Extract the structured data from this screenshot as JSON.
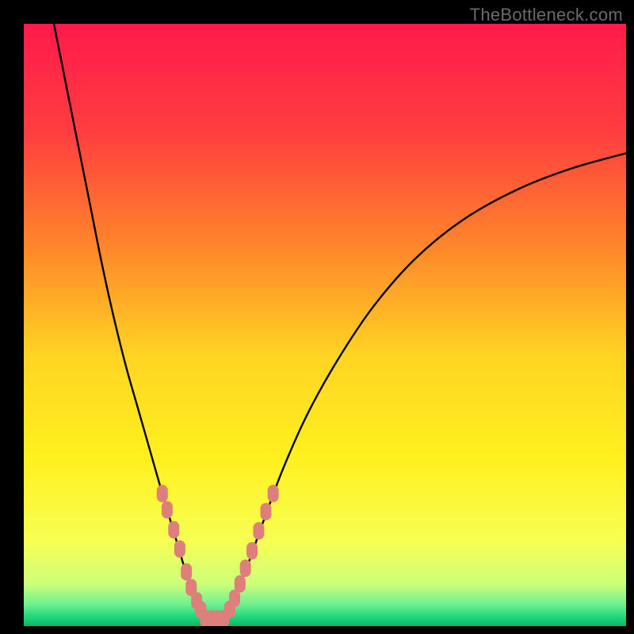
{
  "watermark": "TheBottleneck.com",
  "chart_data": {
    "type": "line",
    "title": "",
    "xlabel": "",
    "ylabel": "",
    "xlim": [
      0,
      100
    ],
    "ylim": [
      0,
      100
    ],
    "background_gradient": {
      "stops": [
        {
          "offset": 0.0,
          "color": "#ff1a4b"
        },
        {
          "offset": 0.18,
          "color": "#ff3e3f"
        },
        {
          "offset": 0.38,
          "color": "#ff8a2a"
        },
        {
          "offset": 0.55,
          "color": "#ffd423"
        },
        {
          "offset": 0.72,
          "color": "#fff01f"
        },
        {
          "offset": 0.86,
          "color": "#f7ff53"
        },
        {
          "offset": 0.93,
          "color": "#ccff7a"
        },
        {
          "offset": 0.965,
          "color": "#6cf08f"
        },
        {
          "offset": 0.985,
          "color": "#1fd67a"
        },
        {
          "offset": 1.0,
          "color": "#0cb56a"
        }
      ]
    },
    "series": [
      {
        "name": "left-branch",
        "comment": "descending curve from top-left into the V minimum",
        "x": [
          5,
          7,
          9,
          11,
          13,
          15,
          17,
          19,
          21,
          23,
          24.5,
          26,
          27,
          27.8,
          28.5,
          29.2,
          30,
          30.5
        ],
        "y": [
          100,
          90,
          80,
          70,
          60,
          51,
          43,
          36,
          29,
          22,
          17,
          12,
          8.5,
          6,
          4.2,
          3,
          1.8,
          1.2
        ]
      },
      {
        "name": "right-branch",
        "comment": "ascending curve from the V minimum out to the right edge",
        "x": [
          33.5,
          34,
          35,
          36,
          37.5,
          40,
          43,
          47,
          52,
          58,
          65,
          73,
          82,
          91,
          100
        ],
        "y": [
          1.2,
          2,
          4,
          7,
          11,
          18,
          26,
          35,
          44,
          53,
          61,
          67.5,
          72.5,
          76,
          78.5
        ]
      },
      {
        "name": "valley-floor",
        "comment": "flat green base at the bottom of the V",
        "x": [
          30.5,
          33.5
        ],
        "y": [
          1.2,
          1.2
        ]
      }
    ],
    "markers": {
      "comment": "salmon pill-shaped markers clustered on lower legs of V and short row on valley floor",
      "color": "#de7f7b",
      "points": [
        {
          "x": 23.0,
          "y": 22.0
        },
        {
          "x": 23.8,
          "y": 19.3
        },
        {
          "x": 24.9,
          "y": 16.0
        },
        {
          "x": 25.9,
          "y": 12.8
        },
        {
          "x": 27.0,
          "y": 9.0
        },
        {
          "x": 27.8,
          "y": 6.4
        },
        {
          "x": 28.7,
          "y": 4.2
        },
        {
          "x": 29.4,
          "y": 2.7
        },
        {
          "x": 30.2,
          "y": 1.2
        },
        {
          "x": 31.2,
          "y": 1.2
        },
        {
          "x": 32.2,
          "y": 1.2
        },
        {
          "x": 33.2,
          "y": 1.2
        },
        {
          "x": 34.2,
          "y": 2.8
        },
        {
          "x": 35.0,
          "y": 4.6
        },
        {
          "x": 35.9,
          "y": 7.0
        },
        {
          "x": 36.8,
          "y": 9.6
        },
        {
          "x": 37.9,
          "y": 12.5
        },
        {
          "x": 39.0,
          "y": 15.8
        },
        {
          "x": 40.2,
          "y": 19.0
        },
        {
          "x": 41.4,
          "y": 22.0
        }
      ]
    }
  }
}
